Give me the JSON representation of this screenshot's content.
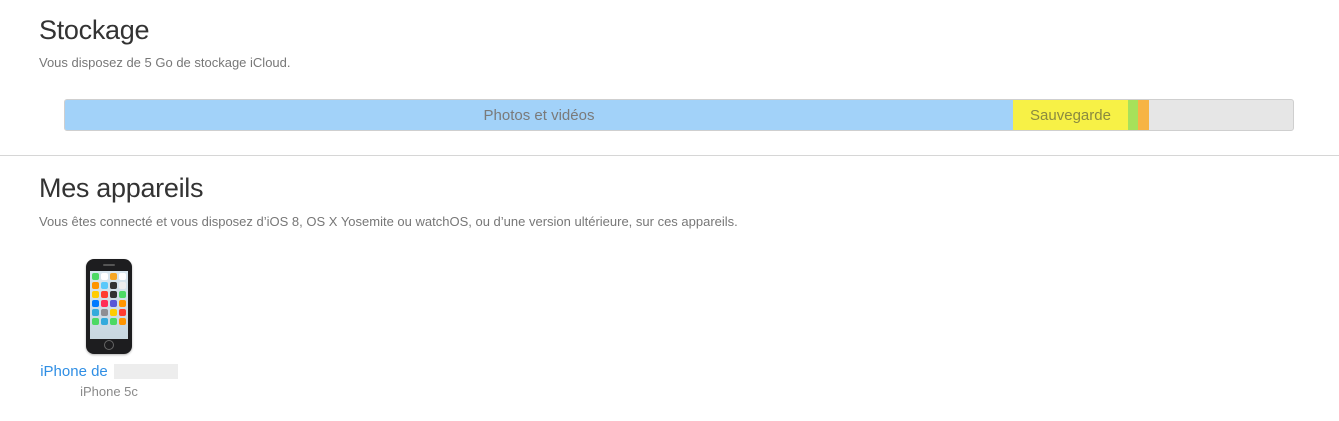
{
  "storage": {
    "title": "Stockage",
    "subtitle": "Vous disposez de 5 Go de stockage iCloud.",
    "segments": [
      {
        "key": "photos",
        "label": "Photos et vidéos",
        "fraction": 0.772,
        "color": "#a2d2f9"
      },
      {
        "key": "backup",
        "label": "Sauvegarde",
        "fraction": 0.094,
        "color": "#f7f146"
      },
      {
        "key": "other1",
        "label": "",
        "fraction": 0.008,
        "color": "#a7e15a"
      },
      {
        "key": "other2",
        "label": "",
        "fraction": 0.009,
        "color": "#f7b445"
      }
    ],
    "free_color": "#e6e6e6"
  },
  "devices": {
    "title": "Mes appareils",
    "subtitle": "Vous êtes connecté et vous disposez d’iOS 8, OS X Yosemite ou watchOS, ou d’une version ultérieure, sur ces appareils.",
    "items": [
      {
        "name_prefix": "iPhone de",
        "model": "iPhone 5c",
        "icon": "iphone-icon"
      }
    ]
  },
  "colors": {
    "link": "#2f8ee4",
    "divider": "#d6d6d6"
  }
}
